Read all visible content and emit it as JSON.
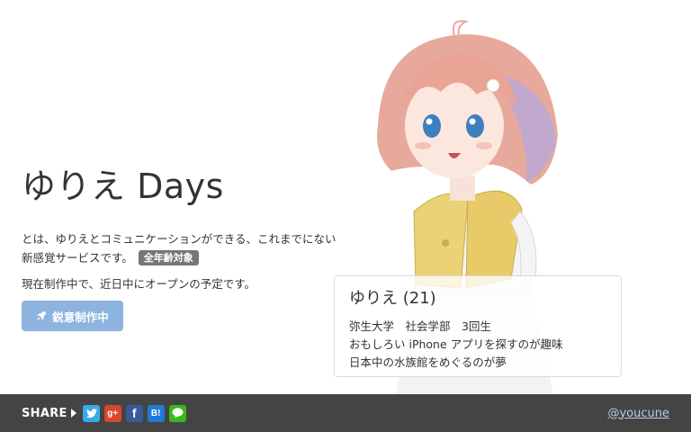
{
  "hero": {
    "title": "ゆりえ Days",
    "lead": "とは、ゆりえとコミュニケーションができる、これまでにない新感覚サービスです。",
    "badge": "全年齢対象",
    "status": "現在制作中で、近日中にオープンの予定です。",
    "wip_button": {
      "label": "鋭意制作中",
      "icon": "rocket-icon"
    }
  },
  "profile": {
    "name": "ゆりえ (21)",
    "lines": [
      "弥生大学　社会学部　3回生",
      "おもしろい iPhone アプリを探すのが趣味",
      "日本中の水族館をめぐるのが夢"
    ]
  },
  "footer": {
    "share_label": "SHARE",
    "social": [
      {
        "icon": "twitter-icon",
        "color": "#3aa9e8"
      },
      {
        "icon": "google-plus-icon",
        "color": "#d9452f",
        "text": "g+"
      },
      {
        "icon": "facebook-icon",
        "color": "#3b5998",
        "text": "f"
      },
      {
        "icon": "hatena-bookmark-icon",
        "color": "#1e7bd5",
        "text": "B!"
      },
      {
        "icon": "line-icon",
        "color": "#3cb71b"
      }
    ],
    "author": "@youcune"
  },
  "colors": {
    "footer_bg": "#444444",
    "button_bg": "#8cb4de",
    "badge_bg": "#777777",
    "link": "#b8cde6"
  }
}
